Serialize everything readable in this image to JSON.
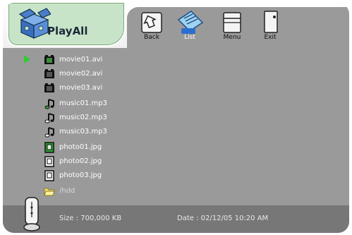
{
  "app": {
    "title": "PlayAll"
  },
  "toolbar": {
    "buttons": [
      {
        "label": "Back",
        "icon": "back-arrow-icon"
      },
      {
        "label": "List",
        "icon": "list-icon"
      },
      {
        "label": "Menu",
        "icon": "menu-icon"
      },
      {
        "label": "Exit",
        "icon": "exit-door-icon"
      }
    ]
  },
  "files": [
    {
      "name": "movie01.avi",
      "type": "video",
      "icon": "film-icon",
      "selected": true
    },
    {
      "name": "movie02.avi",
      "type": "video",
      "icon": "film-icon",
      "selected": false
    },
    {
      "name": "movie03.avi",
      "type": "video",
      "icon": "film-icon",
      "selected": false
    },
    {
      "name": "music01.mp3",
      "type": "audio",
      "icon": "music-note-icon",
      "selected": false
    },
    {
      "name": "music02.mp3",
      "type": "audio",
      "icon": "music-note-icon",
      "selected": false
    },
    {
      "name": "music03.mp3",
      "type": "audio",
      "icon": "music-note-icon",
      "selected": false
    },
    {
      "name": "photo01.jpg",
      "type": "image",
      "icon": "photo-icon",
      "selected": false
    },
    {
      "name": "photo02.jpg",
      "type": "image",
      "icon": "photo-icon",
      "selected": false
    },
    {
      "name": "photo03.jpg",
      "type": "image",
      "icon": "photo-icon",
      "selected": false
    },
    {
      "name": "/hdd",
      "type": "folder",
      "icon": "folder-icon",
      "selected": false
    }
  ],
  "status": {
    "size": "Size : 700,000 KB",
    "date": "Date : 02/12/05  10:20  AM"
  },
  "colors": {
    "panel": "#9a9a9a",
    "status_bar": "#777777",
    "logo_tab": "#c8e4c8",
    "selection_arrow": "#2fcc2f"
  }
}
